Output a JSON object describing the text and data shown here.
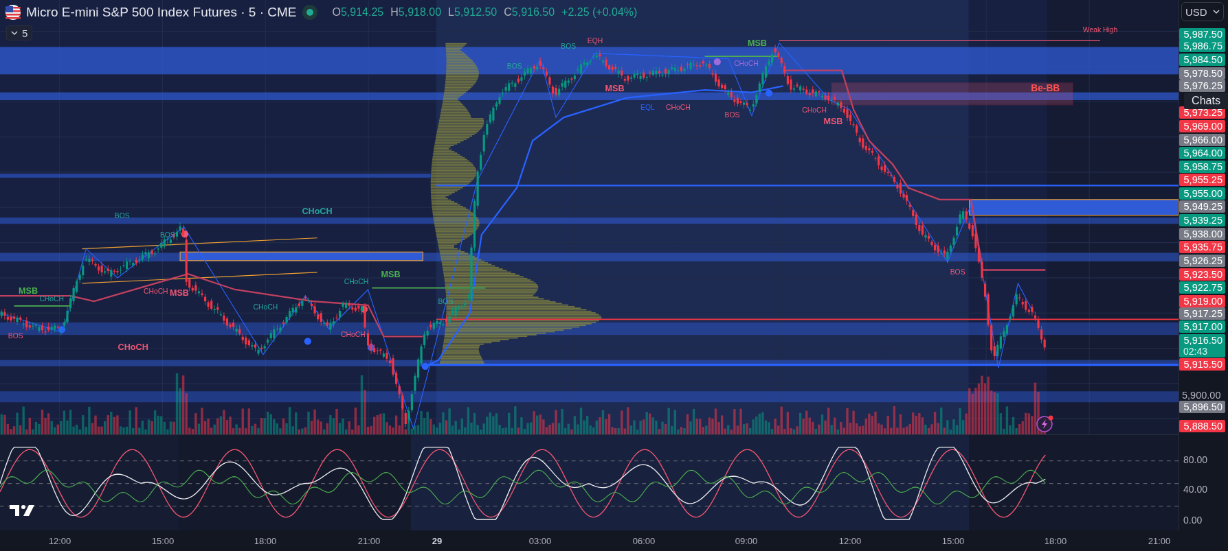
{
  "header": {
    "symbol_title": "Micro E-mini S&P 500 Index Futures · 5 · CME",
    "ohlc": [
      {
        "label": "O",
        "value": "5,914.25"
      },
      {
        "label": "H",
        "value": "5,918.00"
      },
      {
        "label": "L",
        "value": "5,912.50"
      },
      {
        "label": "C",
        "value": "5,916.50"
      }
    ],
    "change": "+2.25 (+0.04%)"
  },
  "interval_button": {
    "label": "5"
  },
  "currency_select": {
    "value": "USD"
  },
  "chats_button": {
    "label": "Chats"
  },
  "price_axis": {
    "labels": [
      {
        "text": "5,987.50",
        "kind": "tag",
        "color": "#089981"
      },
      {
        "text": "5,986.75",
        "kind": "tag",
        "color": "#089981"
      },
      {
        "text": "5,984.50",
        "kind": "tag",
        "color": "#089981"
      },
      {
        "text": "5,978.50",
        "kind": "tag",
        "color": "#787b86"
      },
      {
        "text": "5,976.25",
        "kind": "tag",
        "color": "#787b86"
      },
      {
        "text": "5,973.25",
        "kind": "tag",
        "color": "#f23645"
      },
      {
        "text": "5,969.00",
        "kind": "tag",
        "color": "#f23645"
      },
      {
        "text": "5,966.00",
        "kind": "tag",
        "color": "#787b86"
      },
      {
        "text": "5,964.00",
        "kind": "tag",
        "color": "#089981"
      },
      {
        "text": "5,958.75",
        "kind": "tag",
        "color": "#089981"
      },
      {
        "text": "5,955.25",
        "kind": "tag",
        "color": "#f23645"
      },
      {
        "text": "5,955.00",
        "kind": "tag",
        "color": "#089981"
      },
      {
        "text": "5,949.25",
        "kind": "tag",
        "color": "#787b86"
      },
      {
        "text": "5,939.25",
        "kind": "tag",
        "color": "#089981"
      },
      {
        "text": "5,938.00",
        "kind": "tag",
        "color": "#787b86"
      },
      {
        "text": "5,935.75",
        "kind": "tag",
        "color": "#f23645"
      },
      {
        "text": "5,926.25",
        "kind": "tag",
        "color": "#787b86"
      },
      {
        "text": "5,923.50",
        "kind": "tag",
        "color": "#f23645"
      },
      {
        "text": "5,922.75",
        "kind": "tag",
        "color": "#089981"
      },
      {
        "text": "5,919.00",
        "kind": "tag",
        "color": "#f23645"
      },
      {
        "text": "5,917.25",
        "kind": "tag",
        "color": "#787b86"
      },
      {
        "text": "5,917.00",
        "kind": "tag",
        "color": "#089981"
      },
      {
        "text": "5,916.50",
        "kind": "last",
        "color": "#089981",
        "countdown": "02:43"
      },
      {
        "text": "5,915.50",
        "kind": "tag",
        "color": "#f23645"
      },
      {
        "text": "5,900.00",
        "kind": "tick"
      },
      {
        "text": "5,896.50",
        "kind": "tag",
        "color": "#787b86"
      },
      {
        "text": "5,888.50",
        "kind": "tag",
        "color": "#f23645"
      }
    ]
  },
  "chart_labels": [
    {
      "text": "Weak High",
      "color": "#f05673"
    },
    {
      "text": "BOS",
      "color": "#26a69a"
    },
    {
      "text": "EQH",
      "color": "#f05673"
    },
    {
      "text": "MSB",
      "color": "#4caf50"
    },
    {
      "text": "BOS",
      "color": "#26a69a"
    },
    {
      "text": "CHoCH",
      "color": "#9c6cd8"
    },
    {
      "text": "MSB",
      "color": "#f05673"
    },
    {
      "text": "Be-BB",
      "color": "#ff5252"
    },
    {
      "text": "EQL",
      "color": "#2962ff"
    },
    {
      "text": "CHoCH",
      "color": "#f05673"
    },
    {
      "text": "BOS",
      "color": "#f05673"
    },
    {
      "text": "CHoCH",
      "color": "#f05673"
    },
    {
      "text": "MSB",
      "color": "#f05673"
    },
    {
      "text": "BOS",
      "color": "#26a69a"
    },
    {
      "text": "CHoCH",
      "color": "#26a69a"
    },
    {
      "text": "BOS",
      "color": "#26a69a"
    },
    {
      "text": "MSB",
      "color": "#4caf50"
    },
    {
      "text": "BOS",
      "color": "#f05673"
    },
    {
      "text": "MSB",
      "color": "#4caf50"
    },
    {
      "text": "CHoCH",
      "color": "#26a69a"
    },
    {
      "text": "CHoCH",
      "color": "#f05673"
    },
    {
      "text": "MSB",
      "color": "#f05673"
    },
    {
      "text": "CHoCH",
      "color": "#26a69a"
    },
    {
      "text": "BOS",
      "color": "#26a69a"
    },
    {
      "text": "CHoCH",
      "color": "#26a69a"
    },
    {
      "text": "BOS",
      "color": "#f05673"
    },
    {
      "text": "CHoCH",
      "color": "#f05673"
    },
    {
      "text": "CHoCH",
      "color": "#f05673"
    }
  ],
  "oscillator_axis": {
    "labels": [
      "80.00",
      "40.00",
      "0.00"
    ]
  },
  "time_axis": {
    "labels": [
      {
        "text": "12:00",
        "kind": "time"
      },
      {
        "text": "15:00",
        "kind": "time"
      },
      {
        "text": "18:00",
        "kind": "time"
      },
      {
        "text": "21:00",
        "kind": "time"
      },
      {
        "text": "29",
        "kind": "day"
      },
      {
        "text": "03:00",
        "kind": "time"
      },
      {
        "text": "06:00",
        "kind": "time"
      },
      {
        "text": "09:00",
        "kind": "time"
      },
      {
        "text": "12:00",
        "kind": "time"
      },
      {
        "text": "15:00",
        "kind": "time"
      },
      {
        "text": "18:00",
        "kind": "time"
      },
      {
        "text": "21:00",
        "kind": "time"
      }
    ]
  }
}
